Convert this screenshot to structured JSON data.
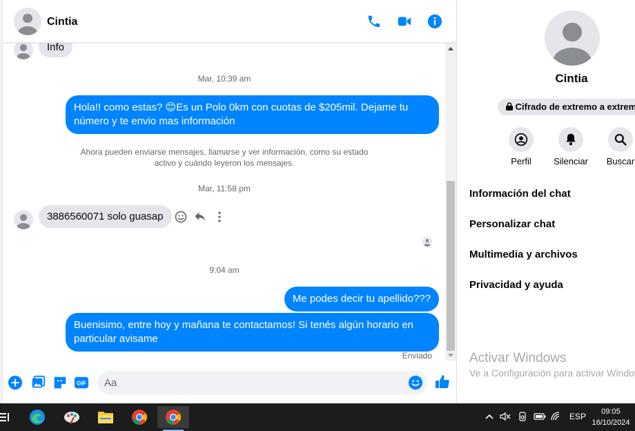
{
  "header": {
    "contact_name": "Cintia"
  },
  "messages": {
    "prev_bubble": "Info",
    "ts1": "Mar, 10:39 am",
    "out1": "Hola!! como estas? 😊Es un Polo 0km con cuotas de $205mil. Dejame tu número y te envio mas información",
    "notice": "Ahora pueden enviarse mensajes, llamarse y ver información, como su estado activo y cuándo leyeron los mensajes.",
    "ts2": "Mar, 11:58 pm",
    "in1": "3886560071 solo guasap",
    "ts3": "9:04 am",
    "out2": "Me podes decir tu apellido???",
    "out3": "Buenisimo, entre hoy y mañana te contactamos! Si tenés algún horario en particular avisame",
    "status": "Enviado"
  },
  "composer": {
    "placeholder": "Aa"
  },
  "panel": {
    "name": "Cintia",
    "encryption": "Cifrado de extremo a extremo",
    "actions": [
      "Perfil",
      "Silenciar",
      "Buscar"
    ],
    "menu": [
      "Información del chat",
      "Personalizar chat",
      "Multimedia y archivos",
      "Privacidad y ayuda"
    ],
    "watermark_title": "Activar Windows",
    "watermark_sub": "Ve a Configuración para activar Windows."
  },
  "taskbar": {
    "lang": "ESP",
    "time": "09:05",
    "date": "16/10/2024"
  },
  "colors": {
    "accent": "#0084ff",
    "bubble_in": "#e4e6eb",
    "taskbar": "#1c1c1c"
  },
  "icons": [
    "phone-icon",
    "video-icon",
    "info-icon",
    "plus-icon",
    "image-icon",
    "sticker-icon",
    "gif-icon",
    "emoji-icon",
    "like-icon",
    "react-icon",
    "reply-icon",
    "more-icon",
    "lock-icon",
    "profile-icon",
    "bell-icon",
    "search-icon"
  ]
}
